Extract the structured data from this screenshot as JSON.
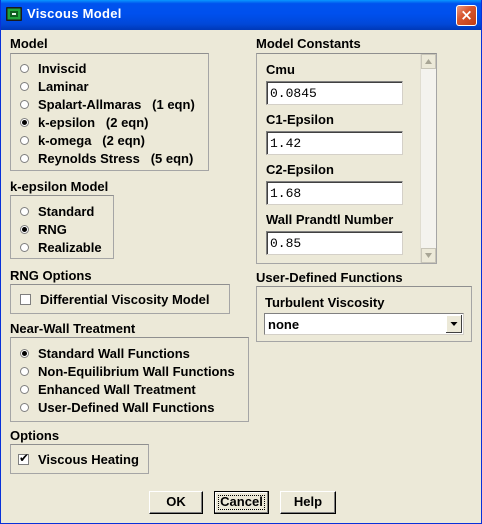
{
  "window": {
    "title": "Viscous Model",
    "close_glyph": "×"
  },
  "model": {
    "title": "Model",
    "options": [
      {
        "label": "Inviscid",
        "selected": false
      },
      {
        "label": "Laminar",
        "selected": false
      },
      {
        "label": "Spalart-Allmaras   (1 eqn)",
        "selected": false
      },
      {
        "label": "k-epsilon   (2 eqn)",
        "selected": true
      },
      {
        "label": "k-omega   (2 eqn)",
        "selected": false
      },
      {
        "label": "Reynolds Stress   (5 eqn)",
        "selected": false
      }
    ]
  },
  "kepsilon_model": {
    "title": "k-epsilon Model",
    "options": [
      {
        "label": "Standard",
        "selected": false
      },
      {
        "label": "RNG",
        "selected": true
      },
      {
        "label": "Realizable",
        "selected": false
      }
    ]
  },
  "rng_options": {
    "title": "RNG Options",
    "differential_viscosity": {
      "label": "Differential Viscosity Model",
      "checked": false
    }
  },
  "near_wall": {
    "title": "Near-Wall Treatment",
    "options": [
      {
        "label": "Standard Wall Functions",
        "selected": true
      },
      {
        "label": "Non-Equilibrium Wall Functions",
        "selected": false
      },
      {
        "label": "Enhanced Wall Treatment",
        "selected": false
      },
      {
        "label": "User-Defined Wall Functions",
        "selected": false
      }
    ]
  },
  "options": {
    "title": "Options",
    "viscous_heating": {
      "label": "Viscous Heating",
      "checked": true
    }
  },
  "model_constants": {
    "title": "Model Constants",
    "fields": [
      {
        "label": "Cmu",
        "value": "0.0845"
      },
      {
        "label": "C1-Epsilon",
        "value": "1.42"
      },
      {
        "label": "C2-Epsilon",
        "value": "1.68"
      },
      {
        "label": "Wall Prandtl Number",
        "value": "0.85"
      }
    ]
  },
  "udf": {
    "title": "User-Defined Functions",
    "turbulent_viscosity": {
      "label": "Turbulent Viscosity",
      "value": "none"
    }
  },
  "buttons": {
    "ok": "OK",
    "cancel": "Cancel",
    "help": "Help"
  },
  "colors": {
    "titlebar": "#0053ee",
    "dialog_bg": "#ece9d8",
    "close_button": "#d9572f"
  },
  "icons": {
    "app": "fluent-app-icon",
    "close": "close-icon",
    "dropdown": "chevron-down-icon",
    "scroll_up": "scroll-up-arrow-icon",
    "scroll_down": "scroll-down-arrow-icon",
    "check": "check-icon"
  }
}
